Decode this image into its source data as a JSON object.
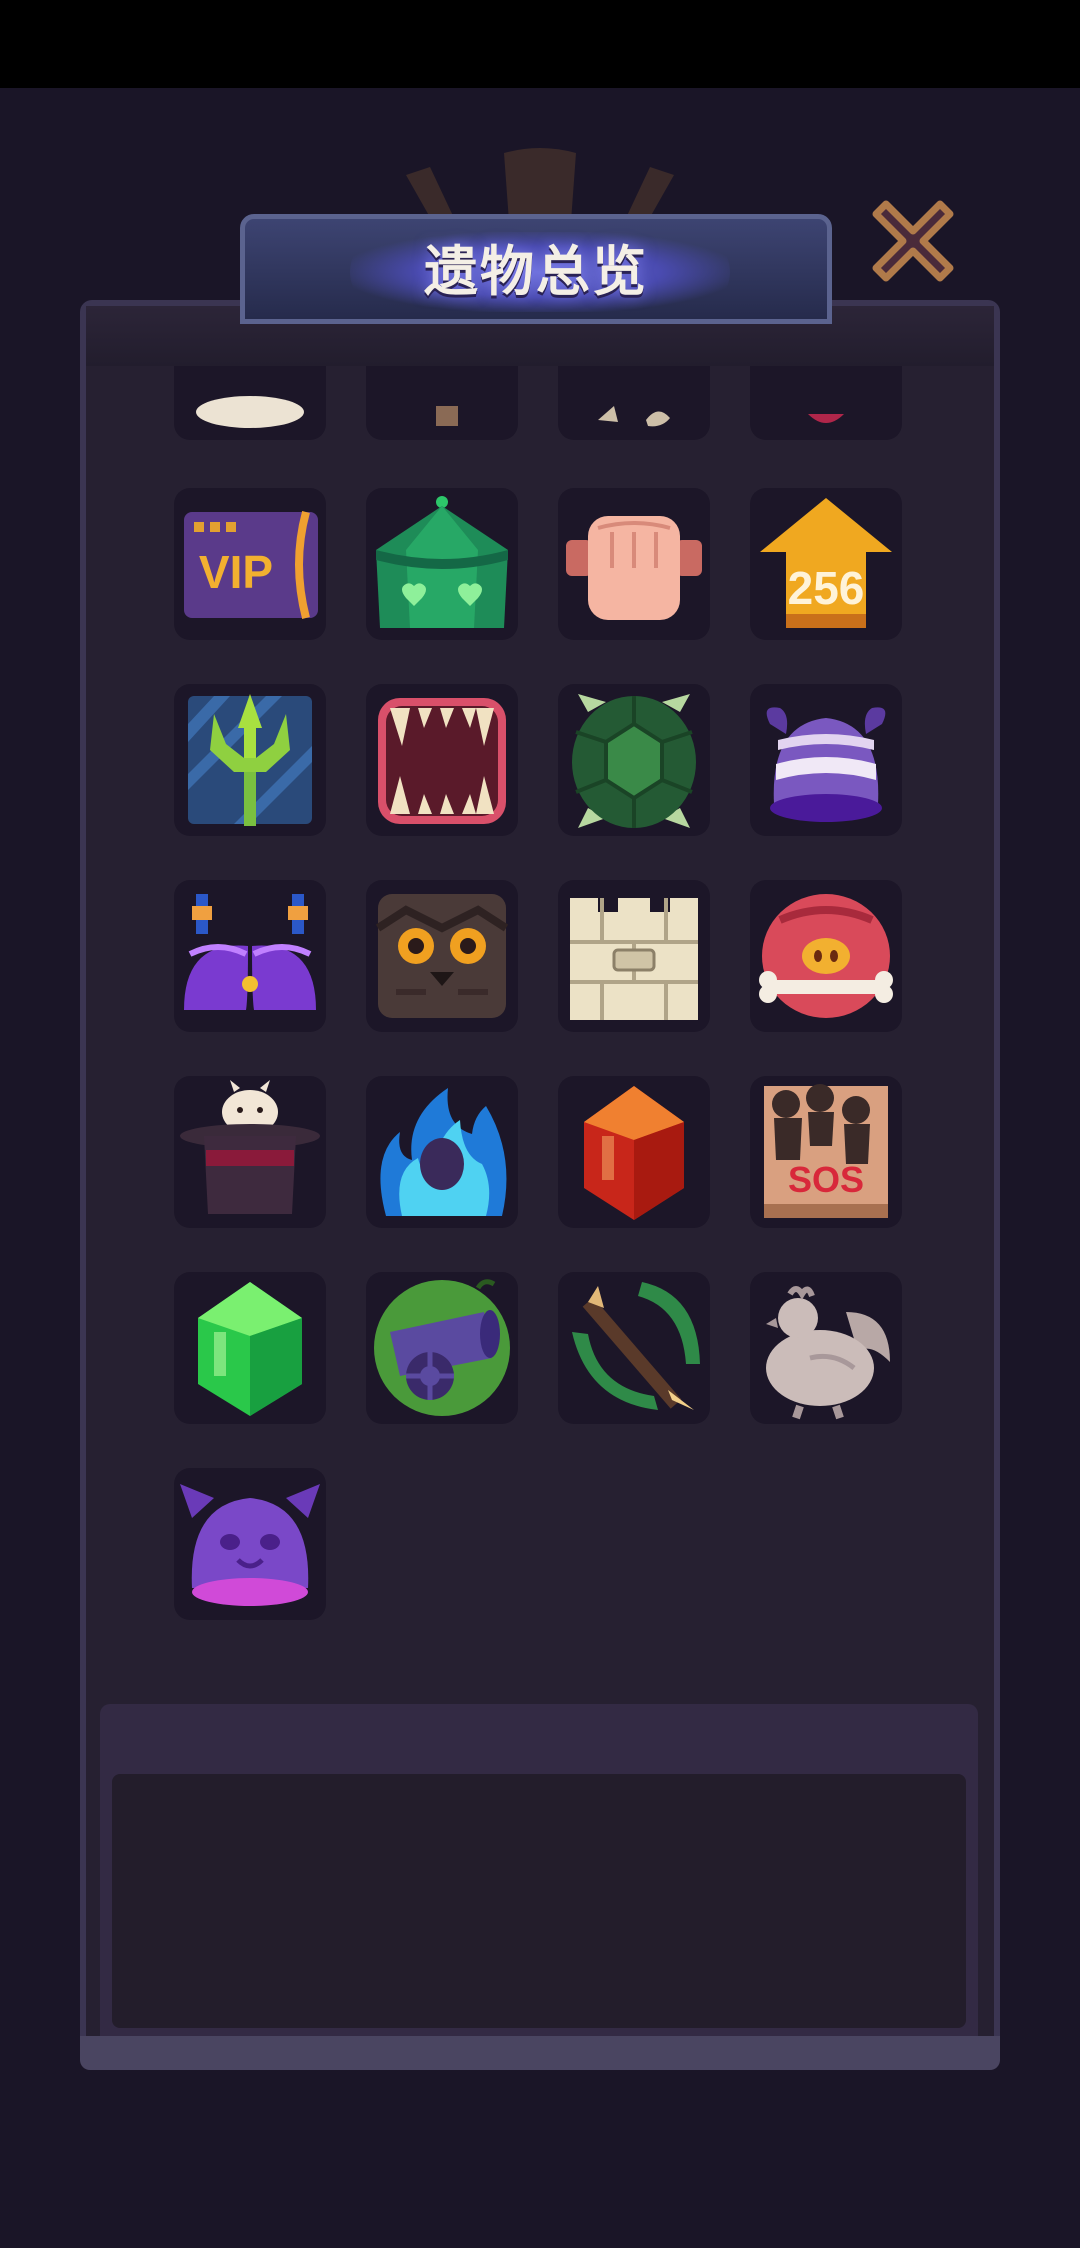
{
  "title": "遗物总览",
  "close_button": {
    "icon": "close-icon",
    "label": ""
  },
  "colors": {
    "background": "#1a1527",
    "panel": "#262031",
    "tile": "#1c1628",
    "title_glow": "#6c6fd8",
    "close_fill": "#4a2a3a",
    "close_border": "#b07a4a"
  },
  "relics": [
    {
      "id": "partial-cream-icon"
    },
    {
      "id": "partial-bone-icon"
    },
    {
      "id": "partial-claw-icon"
    },
    {
      "id": "partial-red-icon"
    },
    {
      "id": "vip-card-icon"
    },
    {
      "id": "green-tent-icon"
    },
    {
      "id": "fist-icon"
    },
    {
      "id": "arrow-256-icon"
    },
    {
      "id": "trident-icon"
    },
    {
      "id": "fanged-mouth-icon"
    },
    {
      "id": "turtle-shell-icon"
    },
    {
      "id": "purple-striped-hat-icon"
    },
    {
      "id": "purple-bra-icon"
    },
    {
      "id": "owl-block-icon"
    },
    {
      "id": "stone-tower-icon"
    },
    {
      "id": "pig-bone-icon"
    },
    {
      "id": "magic-top-hat-icon"
    },
    {
      "id": "blue-flame-icon"
    },
    {
      "id": "red-gem-icon"
    },
    {
      "id": "movie-poster-icon"
    },
    {
      "id": "green-gem-icon"
    },
    {
      "id": "cannon-icon"
    },
    {
      "id": "crossbow-icon"
    },
    {
      "id": "stone-rooster-icon"
    },
    {
      "id": "bat-helmet-icon"
    }
  ],
  "relic_texts": {
    "vip": "VIP",
    "arrow": "256",
    "poster": "SOS"
  },
  "description": ""
}
